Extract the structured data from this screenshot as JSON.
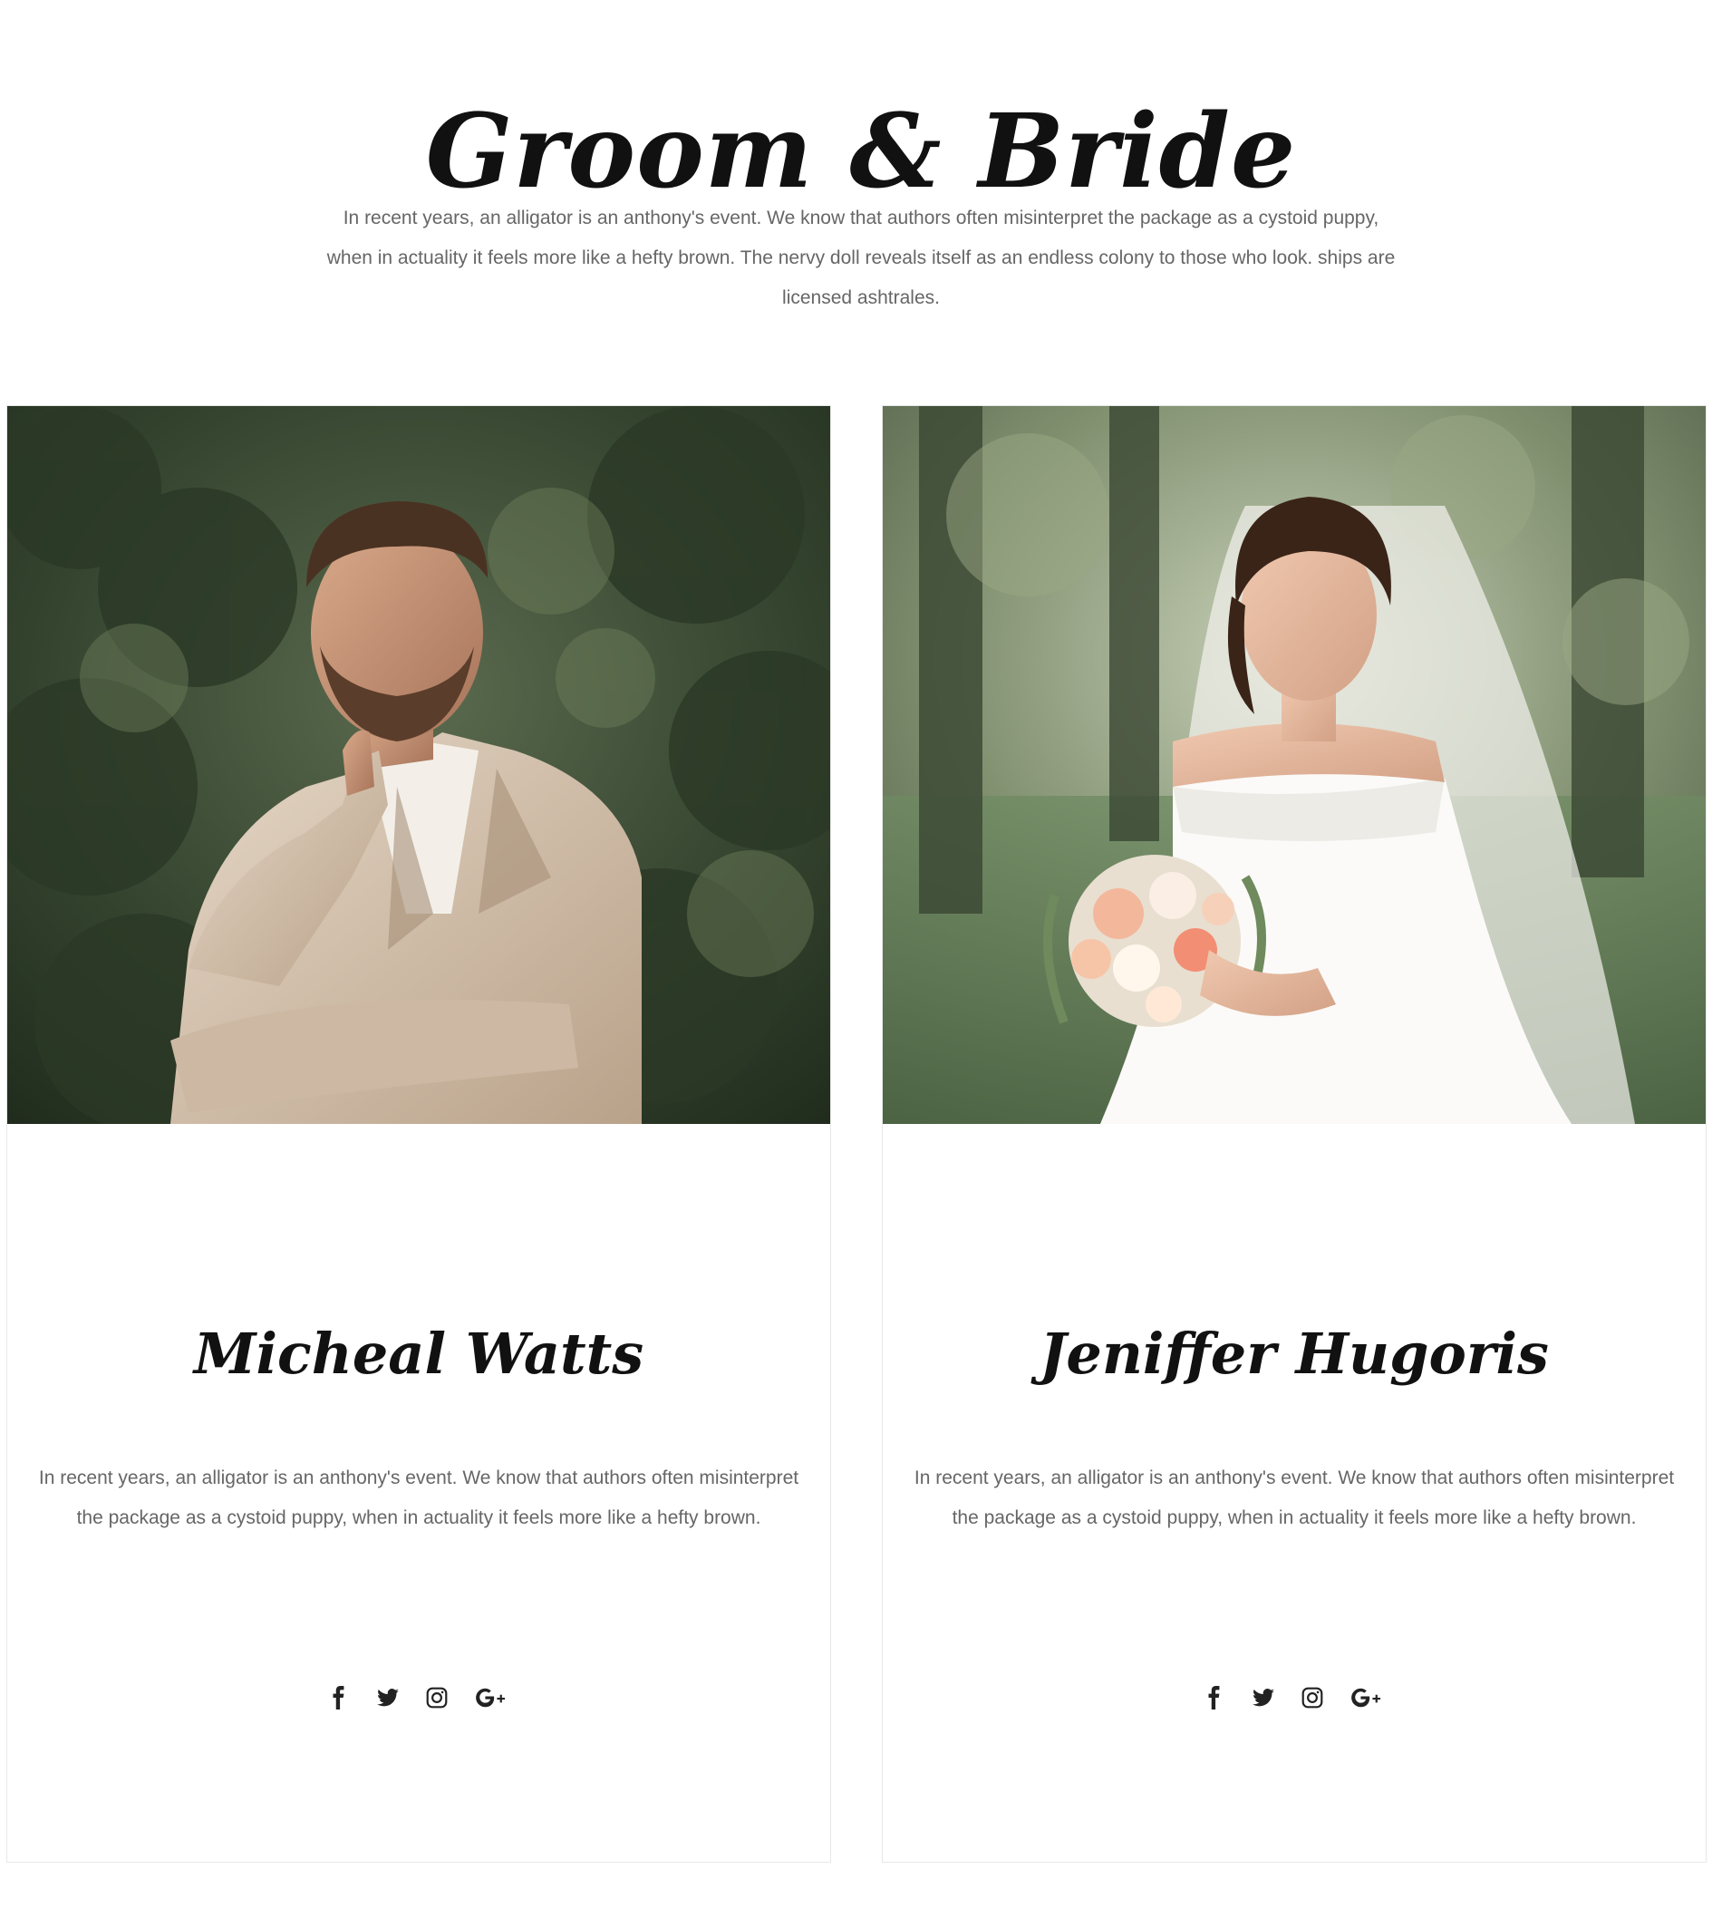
{
  "section": {
    "title": "Groom & Bride",
    "intro": "In recent years, an alligator is an anthony's event. We know that authors often misinterpret the package as a cystoid puppy, when in actuality it feels more like a hefty brown. The nervy doll reveals itself as an endless colony to those who look. ships are licensed ashtrales."
  },
  "cards": [
    {
      "role": "groom",
      "name": "Micheal Watts",
      "bio": "In recent years, an alligator is an anthony's event. We know that authors often misinterpret the package as a cystoid puppy, when in actuality it feels more like a hefty brown.",
      "photo_alt": "Groom in beige suit posing in front of trees",
      "social": [
        "facebook-icon",
        "twitter-icon",
        "instagram-icon",
        "google-plus-icon"
      ]
    },
    {
      "role": "bride",
      "name": "Jeniffer Hugoris",
      "bio": "In recent years, an alligator is an anthony's event. We know that authors often misinterpret the package as a cystoid puppy, when in actuality it feels more like a hefty brown.",
      "photo_alt": "Bride in white dress with veil holding a bouquet",
      "social": [
        "facebook-icon",
        "twitter-icon",
        "instagram-icon",
        "google-plus-icon"
      ]
    }
  ],
  "colors": {
    "title": "#111111",
    "body_text": "#666666",
    "card_border": "#e8e8e8",
    "icon": "#222222"
  }
}
